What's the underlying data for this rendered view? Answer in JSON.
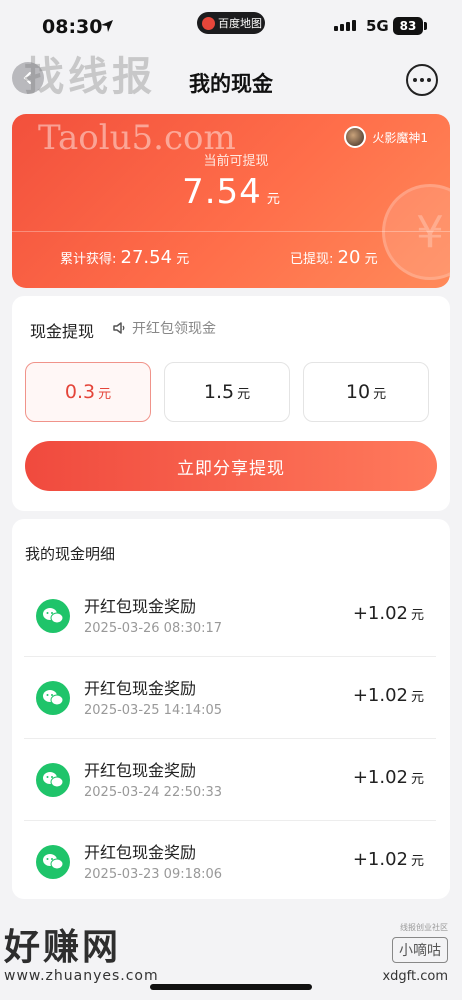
{
  "status_bar": {
    "time": "08:30",
    "map_label": "百度地图",
    "network": "5G",
    "battery": "83"
  },
  "nav": {
    "title": "我的现金"
  },
  "watermarks": {
    "top": "找线报",
    "card": "Taolu5.com",
    "bottom_left_main": "好赚网",
    "bottom_left_url": "www.zhuanyes.com",
    "bottom_right_small": "线报创业社区",
    "bottom_right_box": "小嘀咕",
    "bottom_right_url": "xdgft.com"
  },
  "cash_card": {
    "user_name": "火影魔神1",
    "balance_label": "当前可提现",
    "balance_value": "7.54",
    "balance_unit": "元",
    "total_label": "累计获得:",
    "total_value": "27.54",
    "total_unit": "元",
    "withdrawn_label": "已提现:",
    "withdrawn_value": "20",
    "withdrawn_unit": "元"
  },
  "withdraw": {
    "title": "现金提现",
    "subtitle": "开红包领现金",
    "options": [
      {
        "amount": "0.3",
        "unit": "元",
        "selected": true
      },
      {
        "amount": "1.5",
        "unit": "元",
        "selected": false
      },
      {
        "amount": "10",
        "unit": "元",
        "selected": false
      }
    ],
    "button_label": "立即分享提现"
  },
  "details": {
    "title": "我的现金明细",
    "records": [
      {
        "name": "开红包现金奖励",
        "time": "2025-03-26 08:30:17",
        "amount": "+1.02",
        "unit": "元"
      },
      {
        "name": "开红包现金奖励",
        "time": "2025-03-25 14:14:05",
        "amount": "+1.02",
        "unit": "元"
      },
      {
        "name": "开红包现金奖励",
        "time": "2025-03-24 22:50:33",
        "amount": "+1.02",
        "unit": "元"
      },
      {
        "name": "开红包现金奖励",
        "time": "2025-03-23 09:18:06",
        "amount": "+1.02",
        "unit": "元"
      }
    ]
  },
  "colors": {
    "accent": "#f04a3e",
    "wechat_green": "#1fc46a"
  }
}
